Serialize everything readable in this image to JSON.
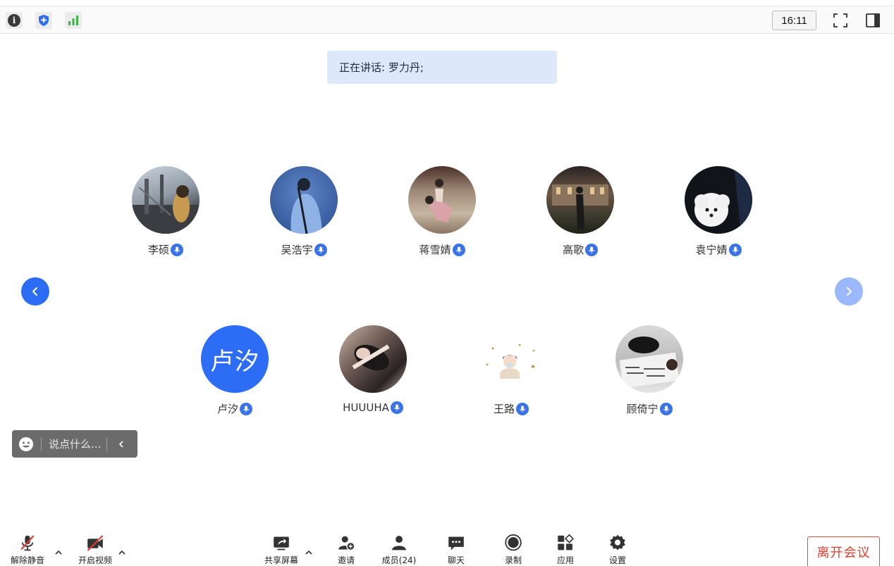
{
  "topbar": {
    "icons": [
      "info-icon",
      "shield-icon",
      "signal-icon"
    ],
    "clock": "16:11",
    "right_icons": [
      "fullscreen-icon",
      "sidebar-toggle-icon"
    ]
  },
  "speaking": {
    "text": "正在讲话: 罗力丹;"
  },
  "participants": {
    "row1": [
      {
        "name": "李硕"
      },
      {
        "name": "吴浩宇"
      },
      {
        "name": "蒋雪婧"
      },
      {
        "name": "高歌"
      },
      {
        "name": "袁宁婧"
      }
    ],
    "row2": [
      {
        "name": "卢汐",
        "initials": "卢汐"
      },
      {
        "name": "HUUUHA"
      },
      {
        "name": "王路"
      },
      {
        "name": "顾倚宁"
      }
    ]
  },
  "chat": {
    "placeholder": "说点什么..."
  },
  "toolbar": {
    "unmute": "解除静音",
    "start_video": "开启视频",
    "share_screen": "共享屏幕",
    "invite": "邀请",
    "members": "成员(24)",
    "chat": "聊天",
    "record": "录制",
    "apps": "应用",
    "settings": "设置",
    "leave": "离开会议"
  },
  "colors": {
    "accent": "#2d6df6",
    "leave": "#e03c2e",
    "banner_bg": "#dde8fb"
  }
}
